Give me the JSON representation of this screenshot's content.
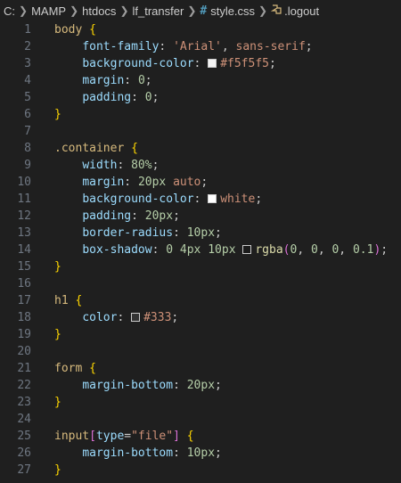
{
  "breadcrumb": {
    "items": [
      "C:",
      "MAMP",
      "htdocs",
      "lf_transfer"
    ],
    "file_icon": "#",
    "file": "style.css",
    "symbol_icon": "selector-icon",
    "symbol": ".logout"
  },
  "lines": [
    {
      "n": "1",
      "tokens": [
        {
          "t": "body",
          "c": "sel"
        },
        {
          "t": " "
        },
        {
          "t": "{",
          "c": "brace"
        }
      ]
    },
    {
      "n": "2",
      "tokens": [
        {
          "t": "    "
        },
        {
          "t": "font-family",
          "c": "prop"
        },
        {
          "t": ": "
        },
        {
          "t": "'Arial'",
          "c": "val"
        },
        {
          "t": ", "
        },
        {
          "t": "sans-serif",
          "c": "val"
        },
        {
          "t": ";"
        }
      ]
    },
    {
      "n": "3",
      "tokens": [
        {
          "t": "    "
        },
        {
          "t": "background-color",
          "c": "prop"
        },
        {
          "t": ": "
        },
        {
          "swatch": "#f5f5f5"
        },
        {
          "t": "#f5f5f5",
          "c": "val"
        },
        {
          "t": ";"
        }
      ]
    },
    {
      "n": "4",
      "tokens": [
        {
          "t": "    "
        },
        {
          "t": "margin",
          "c": "prop"
        },
        {
          "t": ": "
        },
        {
          "t": "0",
          "c": "num"
        },
        {
          "t": ";"
        }
      ]
    },
    {
      "n": "5",
      "tokens": [
        {
          "t": "    "
        },
        {
          "t": "padding",
          "c": "prop"
        },
        {
          "t": ": "
        },
        {
          "t": "0",
          "c": "num"
        },
        {
          "t": ";"
        }
      ]
    },
    {
      "n": "6",
      "tokens": [
        {
          "t": "}",
          "c": "brace"
        }
      ]
    },
    {
      "n": "7",
      "tokens": []
    },
    {
      "n": "8",
      "tokens": [
        {
          "t": ".container",
          "c": "sel"
        },
        {
          "t": " "
        },
        {
          "t": "{",
          "c": "brace"
        }
      ]
    },
    {
      "n": "9",
      "tokens": [
        {
          "t": "    "
        },
        {
          "t": "width",
          "c": "prop"
        },
        {
          "t": ": "
        },
        {
          "t": "80%",
          "c": "num"
        },
        {
          "t": ";"
        }
      ]
    },
    {
      "n": "10",
      "tokens": [
        {
          "t": "    "
        },
        {
          "t": "margin",
          "c": "prop"
        },
        {
          "t": ": "
        },
        {
          "t": "20px",
          "c": "num"
        },
        {
          "t": " "
        },
        {
          "t": "auto",
          "c": "val"
        },
        {
          "t": ";"
        }
      ]
    },
    {
      "n": "11",
      "tokens": [
        {
          "t": "    "
        },
        {
          "t": "background-color",
          "c": "prop"
        },
        {
          "t": ": "
        },
        {
          "swatch": "#ffffff"
        },
        {
          "t": "white",
          "c": "val"
        },
        {
          "t": ";"
        }
      ]
    },
    {
      "n": "12",
      "tokens": [
        {
          "t": "    "
        },
        {
          "t": "padding",
          "c": "prop"
        },
        {
          "t": ": "
        },
        {
          "t": "20px",
          "c": "num"
        },
        {
          "t": ";"
        }
      ]
    },
    {
      "n": "13",
      "tokens": [
        {
          "t": "    "
        },
        {
          "t": "border-radius",
          "c": "prop"
        },
        {
          "t": ": "
        },
        {
          "t": "10px",
          "c": "num"
        },
        {
          "t": ";"
        }
      ]
    },
    {
      "n": "14",
      "tokens": [
        {
          "t": "    "
        },
        {
          "t": "box-shadow",
          "c": "prop"
        },
        {
          "t": ": "
        },
        {
          "t": "0",
          "c": "num"
        },
        {
          "t": " "
        },
        {
          "t": "4px",
          "c": "num"
        },
        {
          "t": " "
        },
        {
          "t": "10px",
          "c": "num"
        },
        {
          "t": " "
        },
        {
          "swatch": "rgba(0,0,0,0.1)"
        },
        {
          "t": "rgba",
          "c": "fn"
        },
        {
          "t": "(",
          "c": "bracket"
        },
        {
          "t": "0",
          "c": "num"
        },
        {
          "t": ", "
        },
        {
          "t": "0",
          "c": "num"
        },
        {
          "t": ", "
        },
        {
          "t": "0",
          "c": "num"
        },
        {
          "t": ", "
        },
        {
          "t": "0.1",
          "c": "num"
        },
        {
          "t": ")",
          "c": "bracket"
        },
        {
          "t": ";"
        }
      ]
    },
    {
      "n": "15",
      "tokens": [
        {
          "t": "}",
          "c": "brace"
        }
      ]
    },
    {
      "n": "16",
      "tokens": []
    },
    {
      "n": "17",
      "tokens": [
        {
          "t": "h1",
          "c": "sel"
        },
        {
          "t": " "
        },
        {
          "t": "{",
          "c": "brace"
        }
      ]
    },
    {
      "n": "18",
      "tokens": [
        {
          "t": "    "
        },
        {
          "t": "color",
          "c": "prop"
        },
        {
          "t": ": "
        },
        {
          "swatch": "#333333"
        },
        {
          "t": "#333",
          "c": "val"
        },
        {
          "t": ";"
        }
      ]
    },
    {
      "n": "19",
      "tokens": [
        {
          "t": "}",
          "c": "brace"
        }
      ]
    },
    {
      "n": "20",
      "tokens": []
    },
    {
      "n": "21",
      "tokens": [
        {
          "t": "form",
          "c": "sel"
        },
        {
          "t": " "
        },
        {
          "t": "{",
          "c": "brace"
        }
      ]
    },
    {
      "n": "22",
      "tokens": [
        {
          "t": "    "
        },
        {
          "t": "margin-bottom",
          "c": "prop"
        },
        {
          "t": ": "
        },
        {
          "t": "20px",
          "c": "num"
        },
        {
          "t": ";"
        }
      ]
    },
    {
      "n": "23",
      "tokens": [
        {
          "t": "}",
          "c": "brace"
        }
      ]
    },
    {
      "n": "24",
      "tokens": []
    },
    {
      "n": "25",
      "tokens": [
        {
          "t": "input",
          "c": "sel"
        },
        {
          "t": "[",
          "c": "bracket"
        },
        {
          "t": "type",
          "c": "attr"
        },
        {
          "t": "="
        },
        {
          "t": "\"file\"",
          "c": "str"
        },
        {
          "t": "]",
          "c": "bracket"
        },
        {
          "t": " "
        },
        {
          "t": "{",
          "c": "brace"
        }
      ]
    },
    {
      "n": "26",
      "tokens": [
        {
          "t": "    "
        },
        {
          "t": "margin-bottom",
          "c": "prop"
        },
        {
          "t": ": "
        },
        {
          "t": "10px",
          "c": "num"
        },
        {
          "t": ";"
        }
      ]
    },
    {
      "n": "27",
      "tokens": [
        {
          "t": "}",
          "c": "brace"
        }
      ]
    }
  ]
}
